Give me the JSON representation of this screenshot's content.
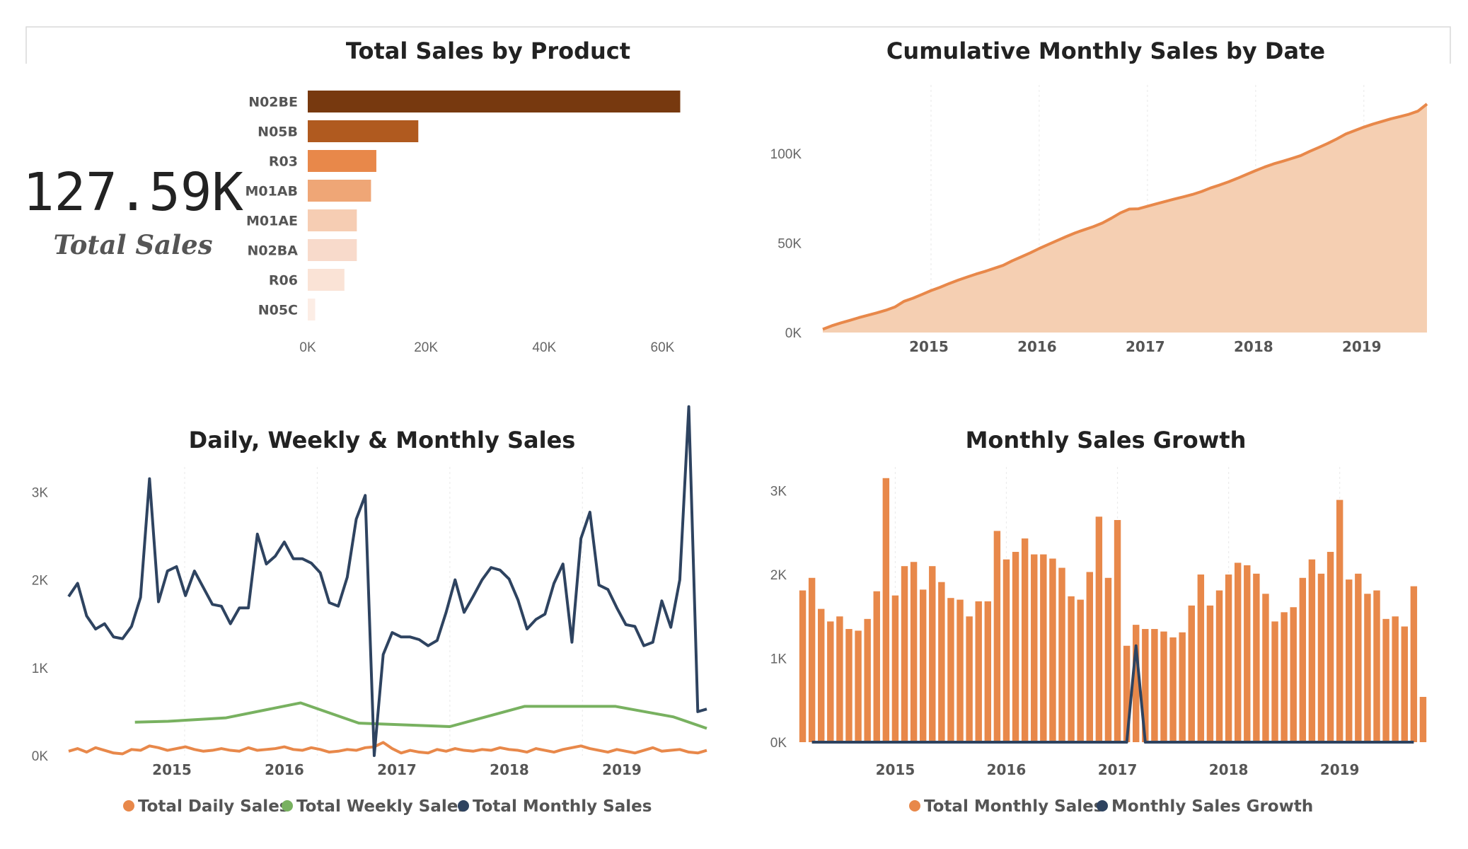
{
  "kpi": {
    "value": "127.59K",
    "label": "Total Sales"
  },
  "legends": {
    "bottom_left": [
      "Total Daily Sales",
      "Total Weekly Sales",
      "Total Monthly Sales"
    ],
    "bottom_right": [
      "Total Monthly Sales",
      "Monthly Sales Growth"
    ]
  },
  "colors": {
    "daily": "#E8884A",
    "weekly": "#78B160",
    "monthly": "#2E4360",
    "area_fill": "#F5CFB2",
    "area_line": "#E8884A",
    "bar": "#E8884A",
    "growth": "#2E4360",
    "product_bars": [
      "#77390F",
      "#B05A1F",
      "#E8884A",
      "#EFA676",
      "#F6CDB3",
      "#F8DACB",
      "#FAE3D6",
      "#FCEDE5"
    ]
  },
  "chart_data": [
    {
      "id": "products",
      "type": "bar",
      "orientation": "horizontal",
      "title": "Total Sales by Product",
      "categories": [
        "N02BE",
        "N05B",
        "R03",
        "M01AB",
        "M01AE",
        "N02BA",
        "R06",
        "N05C"
      ],
      "values": [
        63000,
        18700,
        11600,
        10700,
        8300,
        8300,
        6200,
        1250
      ],
      "xlim": [
        0,
        70000
      ],
      "xticks": [
        0,
        20000,
        40000,
        60000
      ],
      "xtick_labels": [
        "0K",
        "20K",
        "40K",
        "60K"
      ]
    },
    {
      "id": "cumulative",
      "type": "area",
      "title": "Cumulative Monthly Sales by Date",
      "x_start": "2014-01",
      "x_end": "2019-10",
      "ylim": [
        0,
        127590
      ],
      "yticks": [
        0,
        50000,
        100000
      ],
      "ytick_labels": [
        "0K",
        "50K",
        "100K"
      ],
      "xtick_labels": [
        "2015",
        "2016",
        "2017",
        "2018",
        "2019"
      ],
      "values": [
        1810,
        3770,
        5360,
        6800,
        8300,
        9650,
        10980,
        12450,
        14250,
        17400,
        19150,
        21250,
        23400,
        25220,
        27320,
        29230,
        30950,
        32650,
        34150,
        35830,
        37510,
        40030,
        42210,
        44480,
        46910,
        49150,
        51390,
        53580,
        55660,
        57400,
        59100,
        61130,
        63820,
        66780,
        68930,
        69100,
        70500,
        71850,
        73200,
        74520,
        75770,
        77080,
        78710,
        80710,
        82340,
        84150,
        86150,
        88290,
        90400,
        92410,
        94180,
        95620,
        97170,
        98780,
        101140,
        103320,
        105610,
        108080,
        110850,
        112790,
        114680,
        116360,
        117850,
        119320,
        120570,
        121860,
        123620,
        127590
      ]
    },
    {
      "id": "dwm",
      "type": "line",
      "title": "Daily, Weekly & Monthly Sales",
      "x_start": "2014-01",
      "x_end": "2019-10",
      "ylim": [
        0,
        3300
      ],
      "yticks": [
        0,
        1000,
        2000,
        3000
      ],
      "ytick_labels": [
        "0K",
        "1K",
        "2K",
        "3K"
      ],
      "xtick_labels": [
        "2015",
        "2016",
        "2017",
        "2018",
        "2019"
      ],
      "series": [
        {
          "name": "Total Monthly Sales",
          "months": [
            0,
            71
          ],
          "values": [
            1810,
            1960,
            1590,
            1440,
            1500,
            1350,
            1330,
            1470,
            1800,
            3150,
            1750,
            2100,
            2150,
            1820,
            2100,
            1910,
            1720,
            1700,
            1500,
            1680,
            1680,
            2520,
            2180,
            2270,
            2430,
            2240,
            2240,
            2190,
            2080,
            1740,
            1700,
            2030,
            2690,
            2960,
            0,
            1150,
            1400,
            1350,
            1350,
            1320,
            1250,
            1310,
            1630,
            2000,
            1630,
            1810,
            2000,
            2140,
            2110,
            2010,
            1770,
            1440,
            1550,
            1610,
            1960,
            2180,
            1290,
            2470,
            2770,
            1940,
            1890,
            1680,
            1490,
            1470,
            1250,
            1290,
            1760,
            1460,
            2000,
            3970,
            500,
            530
          ]
        },
        {
          "name": "Total Weekly Sales",
          "points": [
            [
              8,
              380
            ],
            [
              12,
              390
            ],
            [
              19,
              430
            ],
            [
              28,
              600
            ],
            [
              35,
              370
            ],
            [
              46,
              330
            ],
            [
              55,
              560
            ],
            [
              66,
              560
            ],
            [
              73,
              440
            ],
            [
              77,
              310
            ]
          ]
        },
        {
          "name": "Total Daily Sales",
          "values": [
            50,
            80,
            40,
            90,
            60,
            30,
            20,
            70,
            60,
            110,
            90,
            60,
            80,
            100,
            70,
            50,
            60,
            80,
            60,
            50,
            90,
            60,
            70,
            80,
            100,
            70,
            60,
            90,
            70,
            40,
            50,
            70,
            60,
            90,
            100,
            150,
            80,
            30,
            60,
            40,
            30,
            70,
            50,
            80,
            60,
            50,
            70,
            60,
            90,
            70,
            60,
            40,
            80,
            60,
            40,
            70,
            90,
            110,
            80,
            60,
            40,
            70,
            50,
            30,
            60,
            90,
            50,
            60,
            70,
            40,
            30,
            60
          ]
        }
      ]
    },
    {
      "id": "growth",
      "type": "bar",
      "title": "Monthly Sales Growth",
      "x_start": "2014-01",
      "x_end": "2019-10",
      "ylim": [
        0,
        3300
      ],
      "yticks": [
        0,
        1000,
        2000,
        3000
      ],
      "ytick_labels": [
        "0K",
        "1K",
        "2K",
        "3K"
      ],
      "xtick_labels": [
        "2015",
        "2016",
        "2017",
        "2018",
        "2019"
      ],
      "series": [
        {
          "name": "Total Monthly Sales",
          "values": [
            1810,
            1960,
            1590,
            1440,
            1500,
            1350,
            1330,
            1470,
            1800,
            3150,
            1750,
            2100,
            2150,
            1820,
            2100,
            1910,
            1720,
            1700,
            1500,
            1680,
            1680,
            2520,
            2180,
            2270,
            2430,
            2240,
            2240,
            2190,
            2080,
            1740,
            1700,
            2030,
            2690,
            1960,
            2650,
            1150,
            1400,
            1350,
            1350,
            1320,
            1250,
            1310,
            1630,
            2000,
            1630,
            1810,
            2000,
            2140,
            2110,
            2010,
            1770,
            1440,
            1550,
            1610,
            1960,
            2180,
            2010,
            2270,
            2890,
            1940,
            2010,
            1770,
            1810,
            1470,
            1500,
            1380,
            1860,
            540
          ]
        },
        {
          "name": "Monthly Sales Growth",
          "values": [
            0,
            0,
            0,
            0,
            0,
            0,
            0,
            0,
            0,
            0,
            0,
            0,
            0,
            0,
            0,
            0,
            0,
            0,
            0,
            0,
            0,
            0,
            0,
            0,
            0,
            0,
            0,
            0,
            0,
            0,
            0,
            0,
            0,
            0,
            0,
            0,
            1150,
            0,
            0,
            0,
            0,
            0,
            0,
            0,
            0,
            0,
            0,
            0,
            0,
            0,
            0,
            0,
            0,
            0,
            0,
            0,
            0,
            0,
            0,
            0,
            0,
            0,
            0,
            0,
            0,
            0,
            0,
            0,
            0,
            0
          ]
        }
      ]
    }
  ]
}
